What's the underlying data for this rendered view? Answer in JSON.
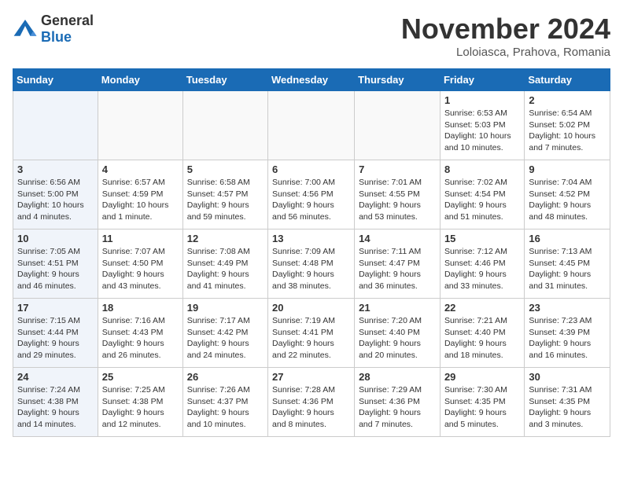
{
  "logo": {
    "general": "General",
    "blue": "Blue"
  },
  "title": "November 2024",
  "location": "Loloiasca, Prahova, Romania",
  "days_of_week": [
    "Sunday",
    "Monday",
    "Tuesday",
    "Wednesday",
    "Thursday",
    "Friday",
    "Saturday"
  ],
  "weeks": [
    [
      {
        "day": "",
        "info": ""
      },
      {
        "day": "",
        "info": ""
      },
      {
        "day": "",
        "info": ""
      },
      {
        "day": "",
        "info": ""
      },
      {
        "day": "",
        "info": ""
      },
      {
        "day": "1",
        "info": "Sunrise: 6:53 AM\nSunset: 5:03 PM\nDaylight: 10 hours and 10 minutes."
      },
      {
        "day": "2",
        "info": "Sunrise: 6:54 AM\nSunset: 5:02 PM\nDaylight: 10 hours and 7 minutes."
      }
    ],
    [
      {
        "day": "3",
        "info": "Sunrise: 6:56 AM\nSunset: 5:00 PM\nDaylight: 10 hours and 4 minutes."
      },
      {
        "day": "4",
        "info": "Sunrise: 6:57 AM\nSunset: 4:59 PM\nDaylight: 10 hours and 1 minute."
      },
      {
        "day": "5",
        "info": "Sunrise: 6:58 AM\nSunset: 4:57 PM\nDaylight: 9 hours and 59 minutes."
      },
      {
        "day": "6",
        "info": "Sunrise: 7:00 AM\nSunset: 4:56 PM\nDaylight: 9 hours and 56 minutes."
      },
      {
        "day": "7",
        "info": "Sunrise: 7:01 AM\nSunset: 4:55 PM\nDaylight: 9 hours and 53 minutes."
      },
      {
        "day": "8",
        "info": "Sunrise: 7:02 AM\nSunset: 4:54 PM\nDaylight: 9 hours and 51 minutes."
      },
      {
        "day": "9",
        "info": "Sunrise: 7:04 AM\nSunset: 4:52 PM\nDaylight: 9 hours and 48 minutes."
      }
    ],
    [
      {
        "day": "10",
        "info": "Sunrise: 7:05 AM\nSunset: 4:51 PM\nDaylight: 9 hours and 46 minutes."
      },
      {
        "day": "11",
        "info": "Sunrise: 7:07 AM\nSunset: 4:50 PM\nDaylight: 9 hours and 43 minutes."
      },
      {
        "day": "12",
        "info": "Sunrise: 7:08 AM\nSunset: 4:49 PM\nDaylight: 9 hours and 41 minutes."
      },
      {
        "day": "13",
        "info": "Sunrise: 7:09 AM\nSunset: 4:48 PM\nDaylight: 9 hours and 38 minutes."
      },
      {
        "day": "14",
        "info": "Sunrise: 7:11 AM\nSunset: 4:47 PM\nDaylight: 9 hours and 36 minutes."
      },
      {
        "day": "15",
        "info": "Sunrise: 7:12 AM\nSunset: 4:46 PM\nDaylight: 9 hours and 33 minutes."
      },
      {
        "day": "16",
        "info": "Sunrise: 7:13 AM\nSunset: 4:45 PM\nDaylight: 9 hours and 31 minutes."
      }
    ],
    [
      {
        "day": "17",
        "info": "Sunrise: 7:15 AM\nSunset: 4:44 PM\nDaylight: 9 hours and 29 minutes."
      },
      {
        "day": "18",
        "info": "Sunrise: 7:16 AM\nSunset: 4:43 PM\nDaylight: 9 hours and 26 minutes."
      },
      {
        "day": "19",
        "info": "Sunrise: 7:17 AM\nSunset: 4:42 PM\nDaylight: 9 hours and 24 minutes."
      },
      {
        "day": "20",
        "info": "Sunrise: 7:19 AM\nSunset: 4:41 PM\nDaylight: 9 hours and 22 minutes."
      },
      {
        "day": "21",
        "info": "Sunrise: 7:20 AM\nSunset: 4:40 PM\nDaylight: 9 hours and 20 minutes."
      },
      {
        "day": "22",
        "info": "Sunrise: 7:21 AM\nSunset: 4:40 PM\nDaylight: 9 hours and 18 minutes."
      },
      {
        "day": "23",
        "info": "Sunrise: 7:23 AM\nSunset: 4:39 PM\nDaylight: 9 hours and 16 minutes."
      }
    ],
    [
      {
        "day": "24",
        "info": "Sunrise: 7:24 AM\nSunset: 4:38 PM\nDaylight: 9 hours and 14 minutes."
      },
      {
        "day": "25",
        "info": "Sunrise: 7:25 AM\nSunset: 4:38 PM\nDaylight: 9 hours and 12 minutes."
      },
      {
        "day": "26",
        "info": "Sunrise: 7:26 AM\nSunset: 4:37 PM\nDaylight: 9 hours and 10 minutes."
      },
      {
        "day": "27",
        "info": "Sunrise: 7:28 AM\nSunset: 4:36 PM\nDaylight: 9 hours and 8 minutes."
      },
      {
        "day": "28",
        "info": "Sunrise: 7:29 AM\nSunset: 4:36 PM\nDaylight: 9 hours and 7 minutes."
      },
      {
        "day": "29",
        "info": "Sunrise: 7:30 AM\nSunset: 4:35 PM\nDaylight: 9 hours and 5 minutes."
      },
      {
        "day": "30",
        "info": "Sunrise: 7:31 AM\nSunset: 4:35 PM\nDaylight: 9 hours and 3 minutes."
      }
    ]
  ]
}
